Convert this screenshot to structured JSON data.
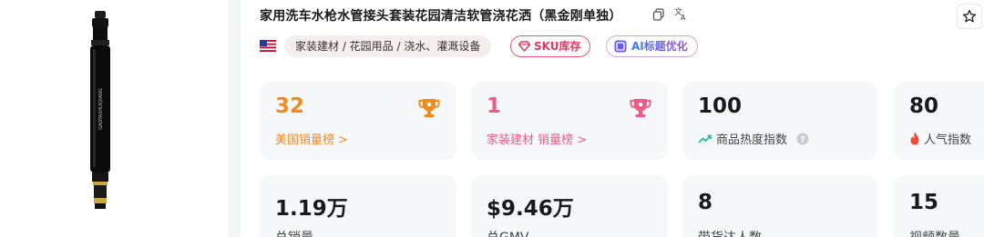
{
  "product": {
    "title": "家用洗车水枪水管接头套装花园清洁软管浇花洒（黑金刚单独）",
    "image_brand_text": "GAOYASHUIQIANG"
  },
  "tags": {
    "category": "家装建材 / 花园用品 / 浇水、灌溉设备",
    "sku_label": "SKU库存",
    "ai_label": "AI标题优化"
  },
  "rank_cards": [
    {
      "value": "32",
      "label": "美国销量榜 >",
      "color": "#f28b1e",
      "icon": "trophy-icon"
    },
    {
      "value": "1",
      "label": "家装建材 销量榜 >",
      "color": "#ef5b86",
      "icon": "trophy-icon"
    }
  ],
  "metric_cards": [
    {
      "value": "100",
      "label": "商品热度指数",
      "icon": "trend-up-icon"
    },
    {
      "value": "80",
      "label": "人气指数",
      "icon": "fire-icon"
    }
  ],
  "stats": [
    {
      "value": "1.19万",
      "label": "总销量"
    },
    {
      "value": "$9.46万",
      "label": "总GMV"
    },
    {
      "value": "8",
      "label": "带货达人数"
    },
    {
      "value": "15",
      "label": "视频数量"
    }
  ],
  "colors": {
    "accent_orange": "#f28b1e",
    "accent_pink": "#ef5b86",
    "card_bg": "#f6f7f9",
    "trend_teal": "#2bb7a8",
    "fire_red": "#f0483e"
  }
}
